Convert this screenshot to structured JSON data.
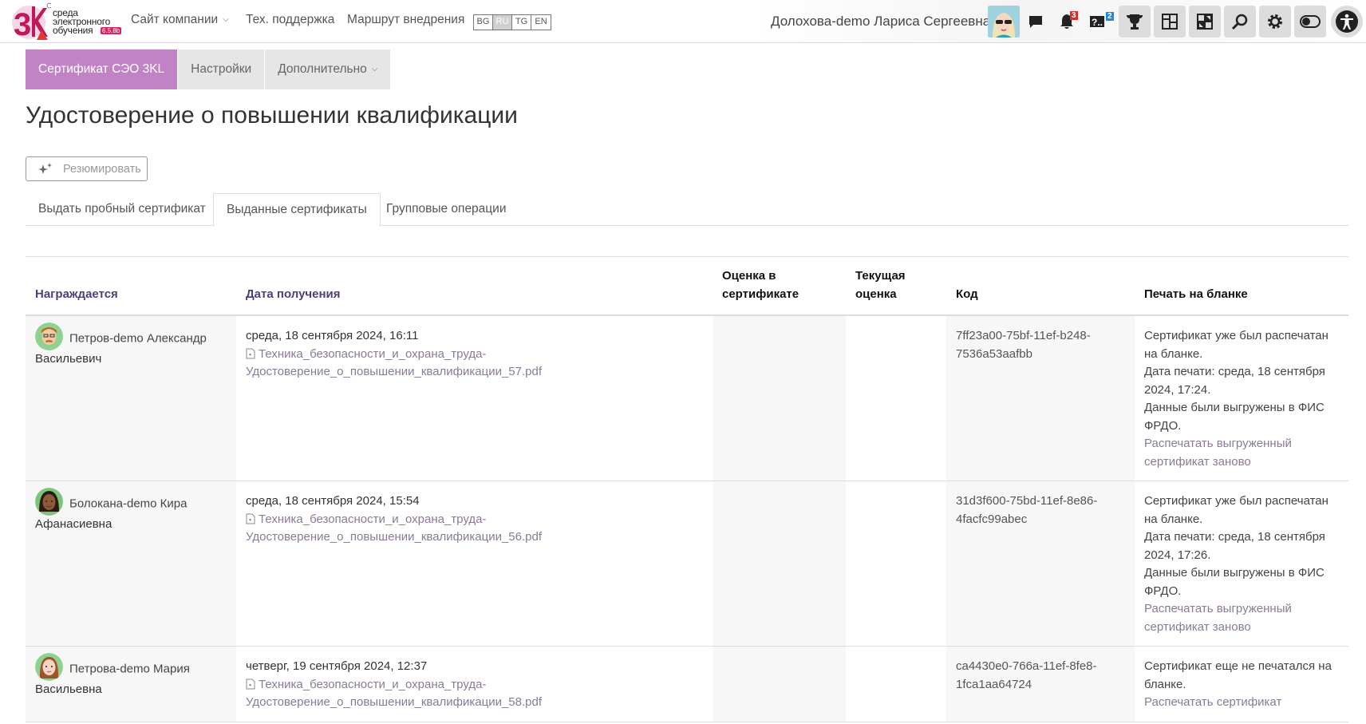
{
  "logo": {
    "line1": "среда",
    "line2": "электронного",
    "line3": "обучения",
    "version": "6.5.8b"
  },
  "nav": {
    "company_site": "Сайт компании",
    "tech_support": "Тех. поддержка",
    "route": "Маршрут внедрения",
    "languages": [
      "BG",
      "RU",
      "TG",
      "EN"
    ]
  },
  "user": {
    "name": "Долохова-demo Лариса Сергеевна"
  },
  "header_icons": [
    {
      "name": "messages-icon"
    },
    {
      "name": "notifications-icon",
      "badge": "3"
    },
    {
      "name": "help-icon",
      "badge": "2"
    },
    {
      "name": "trophy-icon"
    },
    {
      "name": "dashboard-icon"
    },
    {
      "name": "layout-icon"
    },
    {
      "name": "search-icon"
    },
    {
      "name": "gear-icon"
    },
    {
      "name": "toggle-icon"
    },
    {
      "name": "accessibility-icon"
    }
  ],
  "subnav": {
    "items": [
      "Сертификат СЭО 3KL",
      "Настройки",
      "Дополнительно"
    ]
  },
  "page_title": "Удостоверение о повышении квалификации",
  "summarize_button": "Резюмировать",
  "tabs": [
    "Выдать пробный сертификат",
    "Выданные сертификаты",
    "Групповые операции"
  ],
  "table": {
    "headers": {
      "awarded": "Награждается",
      "date": "Дата получения",
      "grade_cert_1": "Оценка в",
      "grade_cert_2": "сертификате",
      "grade_cur_1": "Текущая",
      "grade_cur_2": "оценка",
      "code": "Код",
      "print": "Печать на бланке"
    },
    "rows": [
      {
        "name_1": "Петров-demo Александр",
        "name_2": "Васильевич",
        "date": "среда, 18 сентября 2024, 16:11",
        "file_1": "Техника_безопасности_и_охрана_труда-",
        "file_2": "Удостоверение_о_повышении_квалификации_57.pdf",
        "code_1": "7ff23a00-75bf-11ef-b248-",
        "code_2": "7536a53aafbb",
        "print_1": "Сертификат уже был распечатан",
        "print_2": "на бланке.",
        "print_3": "Дата печати: среда, 18 сентября",
        "print_4": "2024, 17:24.",
        "print_5": "Данные были выгружены в ФИС",
        "print_6": "ФРДО.",
        "print_link_1": "Распечатать выгруженный",
        "print_link_2": "сертификат заново"
      },
      {
        "name_1": "Болокана-demo Кира",
        "name_2": "Афанасиевна",
        "date": "среда, 18 сентября 2024, 15:54",
        "file_1": "Техника_безопасности_и_охрана_труда-",
        "file_2": "Удостоверение_о_повышении_квалификации_56.pdf",
        "code_1": "31d3f600-75bd-11ef-8e86-",
        "code_2": "4facfc99abec",
        "print_1": "Сертификат уже был распечатан",
        "print_2": "на бланке.",
        "print_3": "Дата печати: среда, 18 сентября",
        "print_4": "2024, 17:26.",
        "print_5": "Данные были выгружены в ФИС",
        "print_6": "ФРДО.",
        "print_link_1": "Распечатать выгруженный",
        "print_link_2": "сертификат заново"
      },
      {
        "name_1": "Петрова-demo Мария",
        "name_2": "Васильевна",
        "date": "четверг, 19 сентября 2024, 12:37",
        "file_1": "Техника_безопасности_и_охрана_труда-",
        "file_2": "Удостоверение_о_повышении_квалификации_58.pdf",
        "code_1": "ca4430e0-766a-11ef-8fe8-",
        "code_2": "1fca1aa64724",
        "print_1": "Сертификат еще не печатался на",
        "print_2": "бланке.",
        "print_link_1": "Распечатать сертификат"
      }
    ]
  },
  "colors": {
    "accent": "#c183c5",
    "header_link": "#4e3f7a",
    "link": "#8a7a9a"
  }
}
